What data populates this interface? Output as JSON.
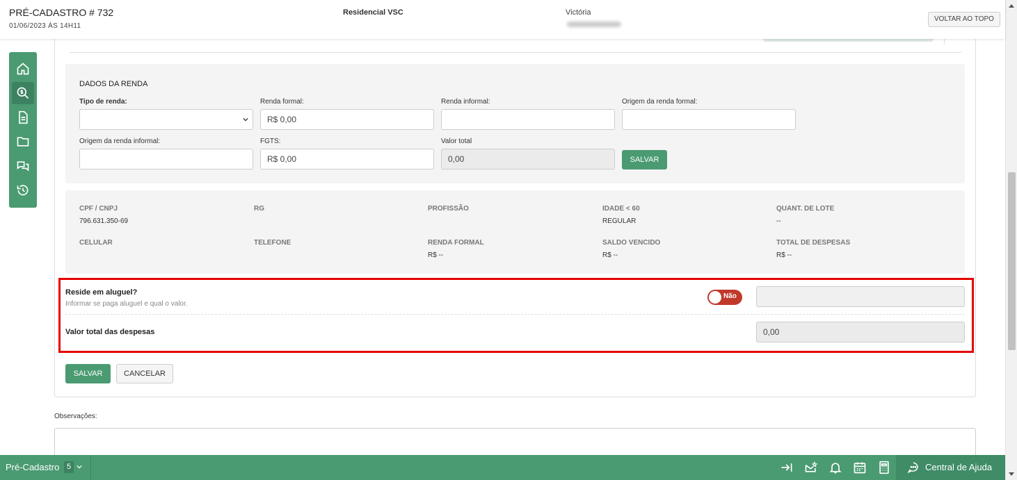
{
  "header": {
    "title": "PRÉ-CADASTRO # 732",
    "date": "01/06/2023 ÀS 14H11",
    "project": "Residencial VSC",
    "user": "Victória",
    "back_to_top": "VOLTAR AO TOPO"
  },
  "sidebar": {
    "items": [
      {
        "icon": "home-icon"
      },
      {
        "icon": "money-search-icon",
        "active": true
      },
      {
        "icon": "document-icon"
      },
      {
        "icon": "folder-icon"
      },
      {
        "icon": "chat-icon"
      },
      {
        "icon": "history-icon"
      }
    ]
  },
  "renda": {
    "title": "DADOS DA RENDA",
    "tipo_label": "Tipo de renda:",
    "tipo_value": "",
    "formal_label": "Renda formal:",
    "formal_value": "R$ 0,00",
    "informal_label": "Renda informal:",
    "informal_value": "",
    "origem_formal_label": "Origem da renda formal:",
    "origem_formal_value": "",
    "origem_informal_label": "Origem da renda informal:",
    "origem_informal_value": "",
    "fgts_label": "FGTS:",
    "fgts_value": "R$ 0,00",
    "total_label": "Valor total",
    "total_value": "0,00",
    "save_label": "SALVAR"
  },
  "info": {
    "cpf_label": "CPF / CNPJ",
    "cpf_value": "796.631.350-69",
    "rg_label": "RG",
    "rg_value": "",
    "profissao_label": "PROFISSÃO",
    "profissao_value": "",
    "idade_label": "IDADE < 60",
    "idade_value": "REGULAR",
    "lote_label": "QUANT. DE LOTE",
    "lote_value": "--",
    "celular_label": "CELULAR",
    "celular_value": "",
    "telefone_label": "TELEFONE",
    "telefone_value": "",
    "renda_formal_label": "RENDA FORMAL",
    "renda_formal_value": "R$ --",
    "saldo_label": "SALDO VENCIDO",
    "saldo_value": "R$ --",
    "despesas_label": "TOTAL DE DESPESAS",
    "despesas_value": "R$ --"
  },
  "rent": {
    "question": "Reside em aluguel?",
    "help": "Informar se paga aluguel e qual o valor.",
    "toggle_label": "Não",
    "value": "",
    "total_label": "Valor total das despesas",
    "total_value": "0,00"
  },
  "actions": {
    "save_label": "SALVAR",
    "cancel_label": "CANCELAR"
  },
  "observacoes": {
    "label": "Observações:"
  },
  "bottombar": {
    "section_label": "Pré-Cadastro",
    "count": "5",
    "help_label": "Central de Ajuda"
  },
  "colors": {
    "accent": "#4a9a72",
    "highlight": "#e60000",
    "toggle_off": "#c0392b"
  }
}
